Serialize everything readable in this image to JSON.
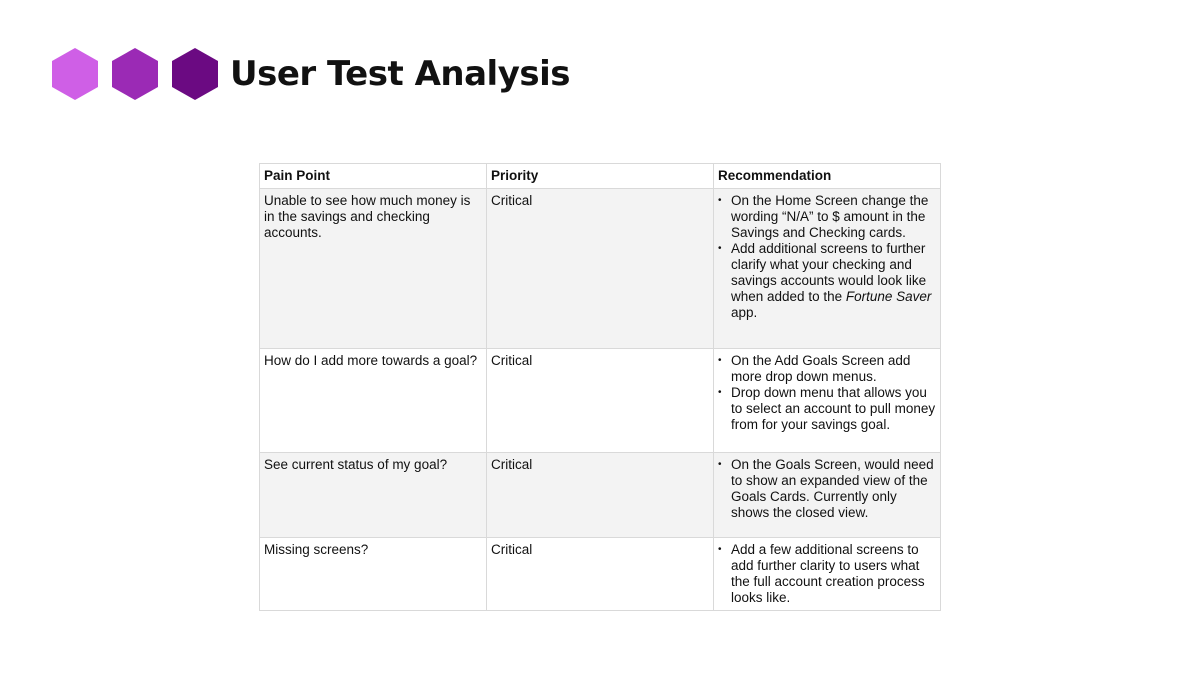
{
  "slide": {
    "title": "User Test Analysis"
  },
  "colors": {
    "hex_light": "#cf5fe6",
    "hex_medium": "#9b2ab5",
    "hex_dark": "#6b0a82"
  },
  "table": {
    "headers": [
      "Pain Point",
      "Priority",
      "Recommendation"
    ],
    "rows": [
      {
        "pain_point": "Unable to see how much money is in the savings and checking accounts.",
        "priority": "Critical",
        "recommendations": [
          "On the Home Screen change the wording “N/A” to $ amount in the Savings and Checking cards.",
          "Add additional screens to further clarify what your checking and savings accounts would look like when added to the Fortune Saver app."
        ]
      },
      {
        "pain_point": "How do I add more towards a goal?",
        "priority": "Critical",
        "recommendations": [
          "On the Add Goals Screen add more drop down menus.",
          "Drop down menu that allows you to select an account to pull money from for your savings goal."
        ]
      },
      {
        "pain_point": "See current status of my goal?",
        "priority": "Critical",
        "recommendations": [
          "On the Goals Screen, would need to show an expanded view of the Goals Cards. Currently only shows the closed view."
        ]
      },
      {
        "pain_point": "Missing screens?",
        "priority": "Critical",
        "recommendations": [
          "Add a few additional screens to add further clarity to users what the full account creation process looks like."
        ]
      }
    ]
  }
}
